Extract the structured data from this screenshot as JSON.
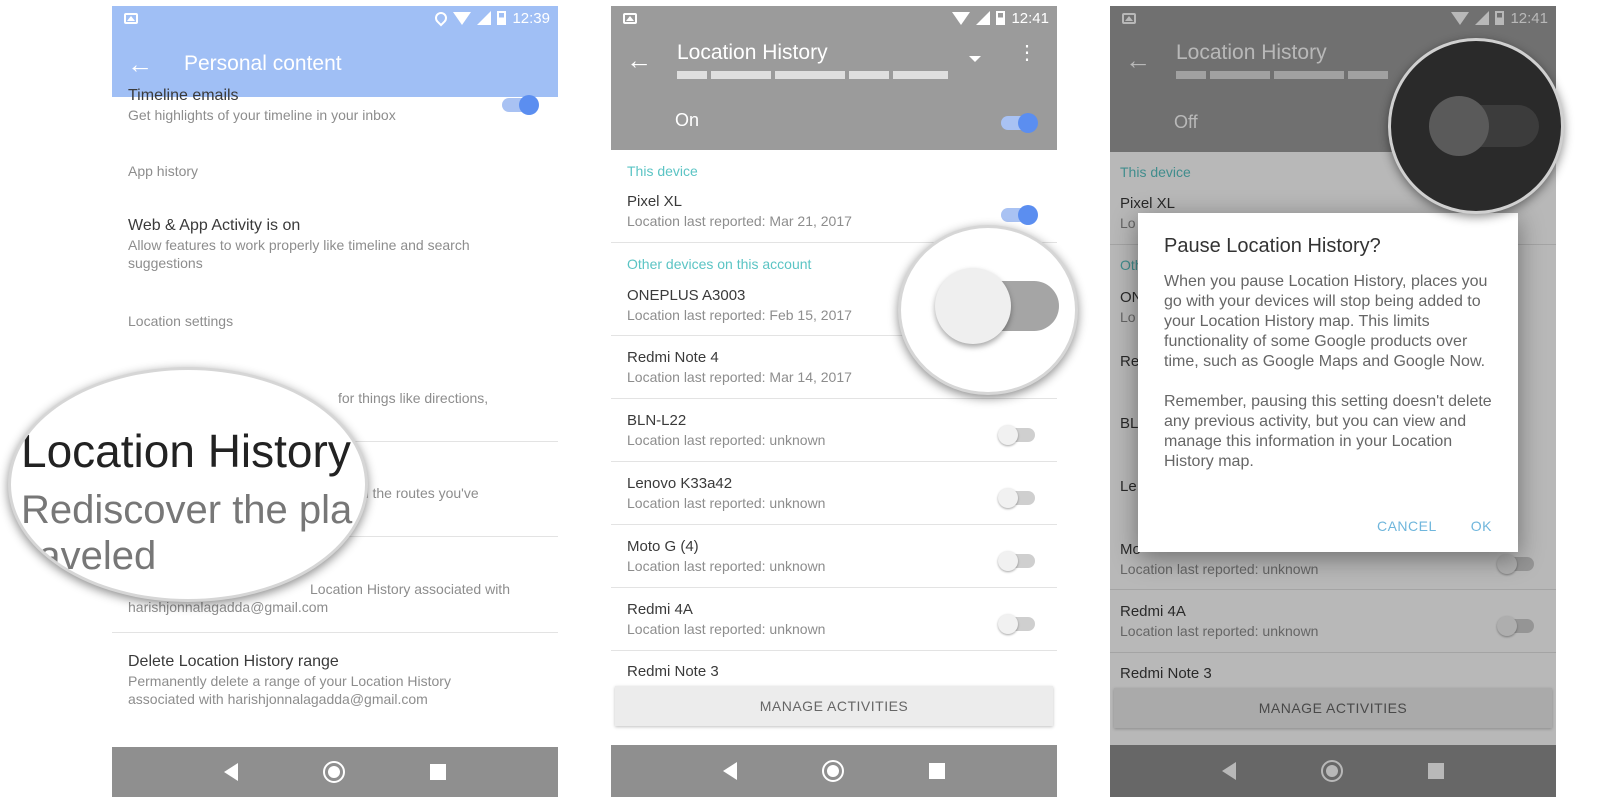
{
  "status": {
    "time1": "12:39",
    "time2": "12:41",
    "time3": "12:41"
  },
  "panel1": {
    "title": "Personal content",
    "timeline_title": "Timeline emails",
    "timeline_sub": "Get highlights of your timeline in your inbox",
    "app_history": "App history",
    "web_title": "Web & App Activity is on",
    "web_sub": "Allow features to work properly like timeline and search suggestions",
    "location_settings": "Location settings",
    "behind1": "for things like directions,",
    "behind2": "nd the routes you've",
    "behind3": "Location History associated with",
    "email": "harishjonnalagadda@gmail.com",
    "delete_title": "Delete Location History range",
    "delete_sub": "Permanently delete a range of your Location History associated with harishjonnalagadda@gmail.com",
    "zoom_title": "Location History",
    "zoom_sub1": "Rediscover the pla",
    "zoom_sub2": "raveled"
  },
  "panel2": {
    "title": "Location History",
    "switch_label": "On",
    "this_device": "This device",
    "other_devices": "Other devices on this account",
    "manage": "MANAGE ACTIVITIES",
    "devices": [
      {
        "name": "Pixel XL",
        "sub": "Location last reported: Mar 21, 2017"
      },
      {
        "name": "ONEPLUS A3003",
        "sub": "Location last reported: Feb 15, 2017"
      },
      {
        "name": "Redmi Note 4",
        "sub": "Location last reported: Mar 14, 2017"
      },
      {
        "name": "BLN-L22",
        "sub": "Location last reported: unknown"
      },
      {
        "name": "Lenovo K33a42",
        "sub": "Location last reported: unknown"
      },
      {
        "name": "Moto G (4)",
        "sub": "Location last reported: unknown"
      },
      {
        "name": "Redmi 4A",
        "sub": "Location last reported: unknown"
      },
      {
        "name": "Redmi Note 3",
        "sub": ""
      }
    ]
  },
  "panel3": {
    "title": "Location History",
    "switch_label": "Off",
    "this_device": "This device",
    "other_devices_partial": "Oth",
    "pixel": "Pixel XL",
    "pixel_sub_partial": "Lo",
    "on_partial": "ON",
    "lo_partial": "Lo",
    "re_partial": "Re",
    "bl_partial": "BL",
    "le_partial": "Le",
    "mo_partial": "Mo",
    "mo_sub": "Location last reported: unknown",
    "redmi4a": "Redmi 4A",
    "redmi4a_sub": "Location last reported: unknown",
    "redmi_note3": "Redmi Note 3",
    "manage": "MANAGE ACTIVITIES",
    "dialog": {
      "title": "Pause Location History?",
      "body1": "When you pause Location History, places you go with your devices will stop being added to your Location History map. This limits functionality of some Google products over time, such as Google Maps and Google Now.",
      "body2": "Remember, pausing this setting doesn't delete any previous activity, but you can view and manage this information in your Location History map.",
      "cancel": "CANCEL",
      "ok": "OK"
    }
  },
  "colors": {
    "blue_header": "#a0bff5",
    "gray_header": "#9b9b9b",
    "accent_teal": "#5bc4c4",
    "toggle_blue": "#5b8ef0"
  }
}
